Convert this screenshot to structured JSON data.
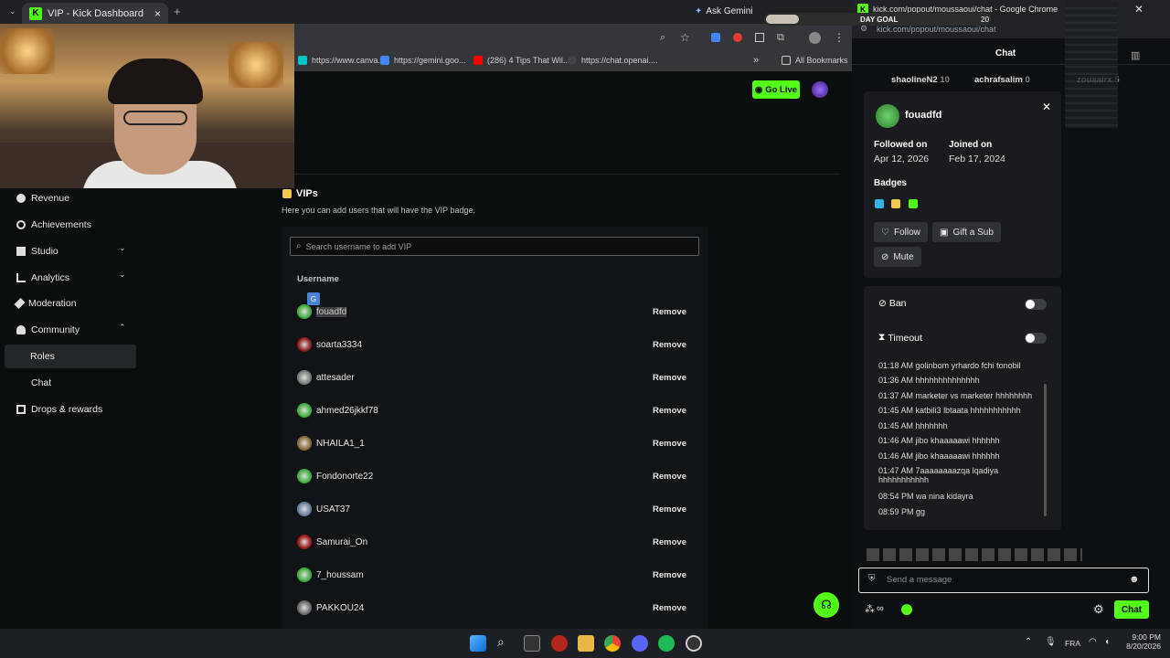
{
  "browser": {
    "tab_title": "VIP - Kick Dashboard",
    "new_tab": "+",
    "close_tab": "×",
    "ask_gemini": "Ask Gemini",
    "bookmarks": [
      {
        "label": "https://www.canva...",
        "color": "#00c4cc"
      },
      {
        "label": "https://gemini.goo...",
        "color": "#4285f4"
      },
      {
        "label": "(286) 4 Tips That Wil...",
        "color": "#ff0000"
      },
      {
        "label": "https://chat.openai....",
        "color": "#202123"
      }
    ],
    "all_bookmarks": "All Bookmarks",
    "more": "»"
  },
  "header": {
    "go_live": "Go Live"
  },
  "sidebar": {
    "items": [
      {
        "label": "Revenue"
      },
      {
        "label": "Achievements"
      },
      {
        "label": "Studio",
        "chevron": "⌄"
      },
      {
        "label": "Analytics",
        "chevron": "⌄"
      },
      {
        "label": "Moderation"
      },
      {
        "label": "Community",
        "chevron": "⌃"
      },
      {
        "label": "Roles"
      },
      {
        "label": "Chat"
      },
      {
        "label": "Drops & rewards"
      }
    ]
  },
  "main": {
    "title": "VIPs",
    "description": "Here you can add users that will have the VIP badge.",
    "search_placeholder": "Search username to add VIP",
    "column_username": "Username",
    "remove_label": "Remove",
    "rows": [
      {
        "name": "fouadfd",
        "color": "#3fae3f"
      },
      {
        "name": "soarta3334",
        "color": "#8a1c1c"
      },
      {
        "name": "attesader",
        "color": "#7a7f7a"
      },
      {
        "name": "ahmed26jkkf78",
        "color": "#3fae3f"
      },
      {
        "name": "NHAILA1_1",
        "color": "#8a6a3a"
      },
      {
        "name": "Fondonorte22",
        "color": "#3fae3f"
      },
      {
        "name": "USAT37",
        "color": "#6a7fa0"
      },
      {
        "name": "Samurai_On",
        "color": "#9a1a1a"
      },
      {
        "name": "7_houssam",
        "color": "#3fae3f"
      },
      {
        "name": "PAKKOU24",
        "color": "#6a6a6a"
      }
    ]
  },
  "popup": {
    "window_title": "kick.com/popout/moussaoui/chat - Google Chrome",
    "url": "kick.com/popout/moussaoui/chat",
    "day_goal": "DAY GOAL",
    "day_goal_value": "20",
    "chat_heading": "Chat",
    "top_users": [
      {
        "name": "shaolineN2",
        "count": "10"
      },
      {
        "name": "achrafsalim",
        "count": "0"
      },
      {
        "name": "zouaairx",
        "count": "5"
      }
    ],
    "user_card": {
      "username": "fouadfd",
      "followed_label": "Followed on",
      "followed_date": "Apr 12, 2026",
      "joined_label": "Joined on",
      "joined_date": "Feb 17, 2024",
      "badges_label": "Badges",
      "follow": "Follow",
      "gift_sub": "Gift a Sub",
      "mute": "Mute",
      "ban": "Ban",
      "timeout": "Timeout"
    },
    "messages": [
      {
        "time": "01:18 AM",
        "text": "golinbom yrhardo fchi tonobil"
      },
      {
        "time": "01:36 AM",
        "text": "hhhhhhhhhhhhhh"
      },
      {
        "time": "01:37 AM",
        "text": "marketer vs marketer hhhhhhhh"
      },
      {
        "time": "01:45 AM",
        "text": "katbili3 lbtaata hhhhhhhhhhh"
      },
      {
        "time": "01:45 AM",
        "text": "hhhhhhh"
      },
      {
        "time": "01:46 AM",
        "text": "jibo khaaaaawi hhhhhh"
      },
      {
        "time": "01:46 AM",
        "text": "jibo khaaaaawi hhhhhh"
      },
      {
        "time": "01:47 AM",
        "text": "7aaaaaaaazqa lqadiya hhhhhhhhhhh"
      },
      {
        "time": "08:54 PM",
        "text": "wa nina kidayra"
      },
      {
        "time": "08:59 PM",
        "text": "gg"
      }
    ],
    "input_placeholder": "Send a message",
    "chat_button": "Chat"
  },
  "taskbar": {
    "language": "FRA",
    "time": "9:00 PM",
    "date": "8/20/2026"
  }
}
